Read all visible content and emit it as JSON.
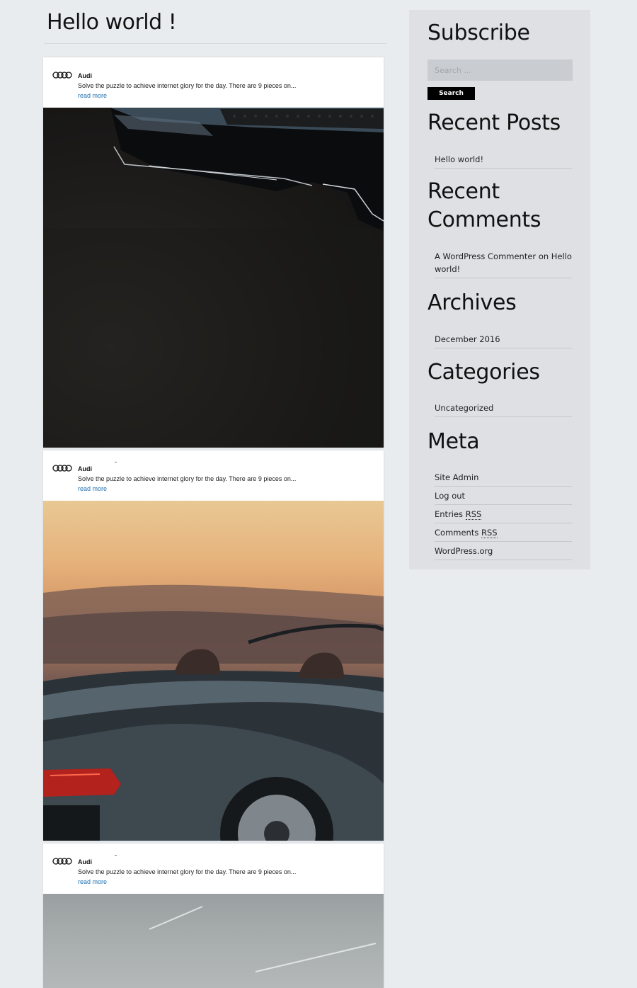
{
  "page": {
    "title": "Hello world !"
  },
  "posts": [
    {
      "brand": "Audi",
      "excerpt": "Solve the puzzle to achieve internet glory for the day. There are 9 pieces on...",
      "read_more": "read more"
    },
    {
      "brand": "Audi",
      "excerpt": "Solve the puzzle to achieve internet glory for the day. There are 9 pieces on...",
      "read_more": "read more"
    },
    {
      "brand": "Audi",
      "excerpt": "Solve the puzzle to achieve internet glory for the day. There are 9 pieces on...",
      "read_more": "read more"
    }
  ],
  "sidebar": {
    "subscribe": {
      "title": "Subscribe",
      "placeholder": "Search ...",
      "button": "Search"
    },
    "recent_posts": {
      "title": "Recent Posts",
      "items": [
        "Hello world!"
      ]
    },
    "recent_comments": {
      "title_line1": "Recent",
      "title_line2": "Comments",
      "author": "A WordPress Commenter",
      "on": "on",
      "post": "Hello world!"
    },
    "archives": {
      "title": "Archives",
      "items": [
        "December 2016"
      ]
    },
    "categories": {
      "title": "Categories",
      "items": [
        "Uncategorized"
      ]
    },
    "meta": {
      "title": "Meta",
      "site_admin": "Site Admin",
      "log_out": "Log out",
      "entries_prefix": "Entries",
      "comments_prefix": "Comments",
      "rss": "RSS",
      "wordpress_org": "WordPress.org"
    }
  },
  "colors": {
    "page_bg": "#e9ecef",
    "sidebar_bg": "#dee0e4",
    "link": "#1f6fb0",
    "button_bg": "#000000"
  }
}
